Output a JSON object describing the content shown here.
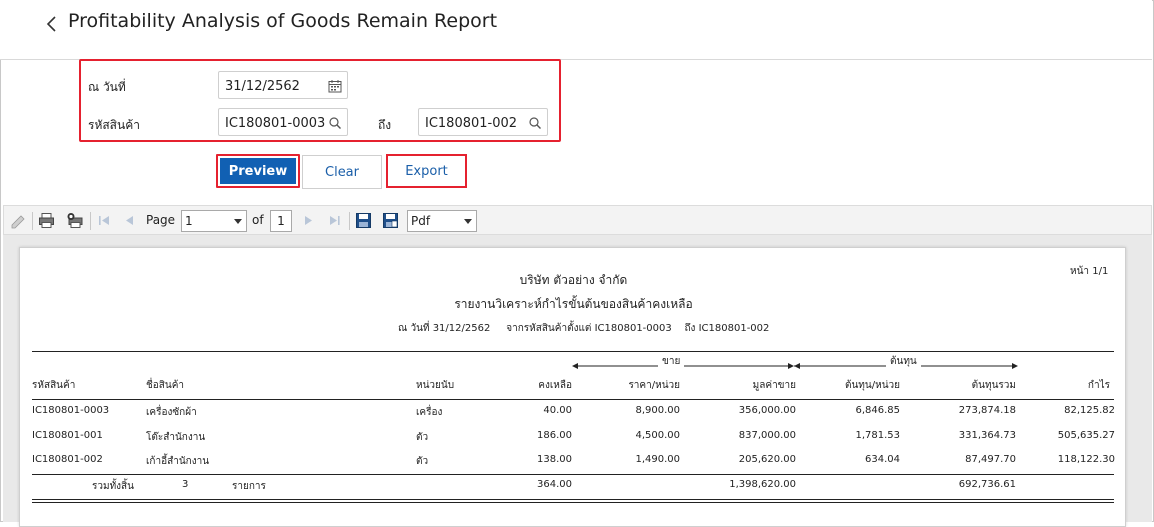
{
  "header": {
    "title": "Profitability Analysis of Goods Remain Report"
  },
  "filters": {
    "date_label": "ณ วันที่",
    "date_value": "31/12/2562",
    "product_label": "รหัสสินค้า",
    "product_from": "IC180801-0003",
    "to_label": "ถึง",
    "product_to": "IC180801-002"
  },
  "buttons": {
    "preview": "Preview",
    "clear": "Clear",
    "export": "Export"
  },
  "toolbar": {
    "page_label": "Page",
    "page_value": "1",
    "of_label": "of",
    "total_pages": "1",
    "format": "Pdf"
  },
  "report": {
    "company": "บริษัท ตัวอย่าง จำกัด",
    "title": "รายงานวิเคราะห์กำไรขั้นต้นของสินค้าคงเหลือ",
    "page_no": "หน้า 1/1",
    "sub_date_label": "ณ วันที่",
    "sub_date": "31/12/2562",
    "sub_from_label": "จากรหัสสินค้าตั้งแต่",
    "sub_from": "IC180801-0003",
    "sub_to_label": "ถึง",
    "sub_to": "IC180801-002",
    "group_sale": "ขาย",
    "group_cost": "ต้นทุน",
    "columns": [
      "รหัสสินค้า",
      "ชื่อสินค้า",
      "หน่วยนับ",
      "คงเหลือ",
      "ราคา/หน่วย",
      "มูลค่าขาย",
      "ต้นทุน/หน่วย",
      "ต้นทุนรวม",
      "กำไร"
    ],
    "rows": [
      [
        "IC180801-0003",
        "เครื่องซักผ้า",
        "เครื่อง",
        "40.00",
        "8,900.00",
        "356,000.00",
        "6,846.85",
        "273,874.18",
        "82,125.82"
      ],
      [
        "IC180801-001",
        "โต๊ะสำนักงาน",
        "ตัว",
        "186.00",
        "4,500.00",
        "837,000.00",
        "1,781.53",
        "331,364.73",
        "505,635.27"
      ],
      [
        "IC180801-002",
        "เก้าอี้สำนักงาน",
        "ตัว",
        "138.00",
        "1,490.00",
        "205,620.00",
        "634.04",
        "87,497.70",
        "118,122.30"
      ]
    ],
    "total": {
      "label": "รวมทั้งสิ้น",
      "count": "3",
      "count_unit": "รายการ",
      "qty": "364.00",
      "sale": "1,398,620.00",
      "cost": "692,736.61"
    }
  }
}
